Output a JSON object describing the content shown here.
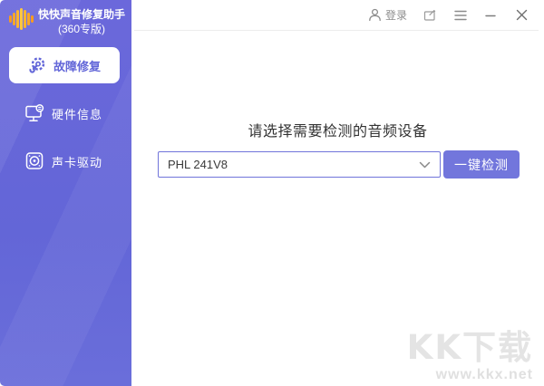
{
  "app": {
    "title_line1": "快快声音修复助手",
    "title_line2": "(360专版)"
  },
  "sidebar": {
    "items": [
      {
        "label": "故障修复",
        "icon": "gear-wrench-icon",
        "active": true
      },
      {
        "label": "硬件信息",
        "icon": "monitor-info-icon",
        "active": false
      },
      {
        "label": "声卡驱动",
        "icon": "soundcard-icon",
        "active": false
      }
    ]
  },
  "topbar": {
    "login_label": "登录",
    "icons": [
      "person-icon",
      "feedback-icon",
      "menu-icon",
      "minimize-icon",
      "close-icon"
    ]
  },
  "main": {
    "prompt": "请选择需要检测的音频设备",
    "device_select": {
      "value": "PHL 241V8",
      "chevron_icon": "chevron-down-icon"
    },
    "detect_button_label": "一键检测"
  },
  "watermark": {
    "line1": "KK下载",
    "line2": "www.kkx.net"
  },
  "colors": {
    "sidebar_purple": "#6467d9",
    "accent_button": "#7276dc",
    "active_item_text": "#6266d8",
    "wave_orange": "#f79b1f",
    "wave_yellow": "#ffc83d",
    "prompt_text": "#333333",
    "topbar_gray": "#8c8c8c",
    "watermark_gray": "#e4e4e4"
  }
}
